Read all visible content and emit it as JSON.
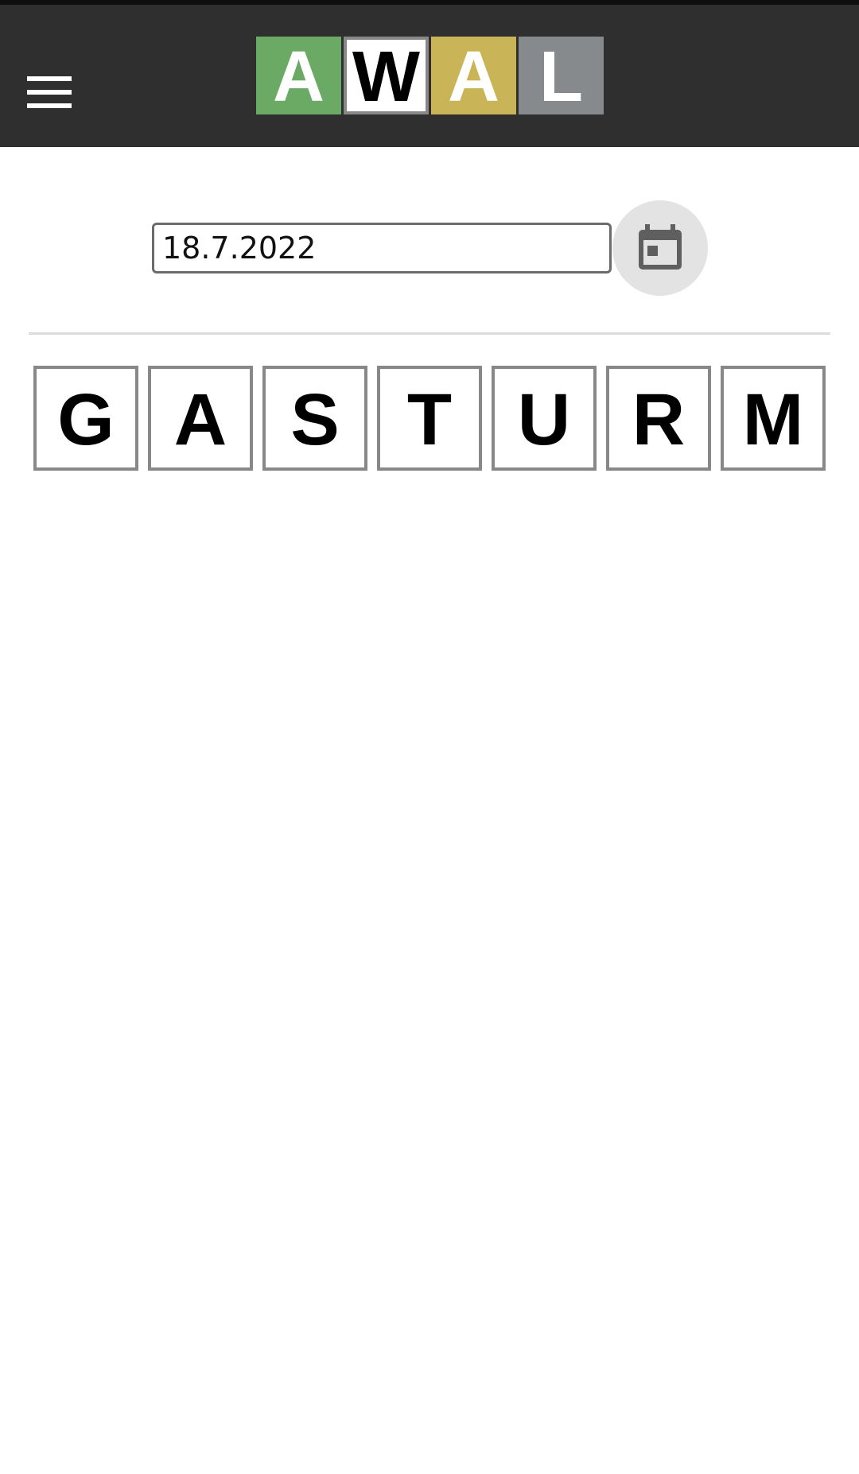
{
  "header": {
    "menu_icon": "hamburger-menu-icon",
    "logo_letters": [
      "A",
      "W",
      "A",
      "L"
    ],
    "logo_colors": [
      "#6aaa64",
      "#ffffff",
      "#c9b458",
      "#878a8c"
    ],
    "background": "#2f2f2f"
  },
  "date_picker": {
    "value": "18.7.2022",
    "calendar_icon": "calendar-icon"
  },
  "word": {
    "letters": [
      "G",
      "A",
      "S",
      "T",
      "U",
      "R",
      "M"
    ]
  }
}
